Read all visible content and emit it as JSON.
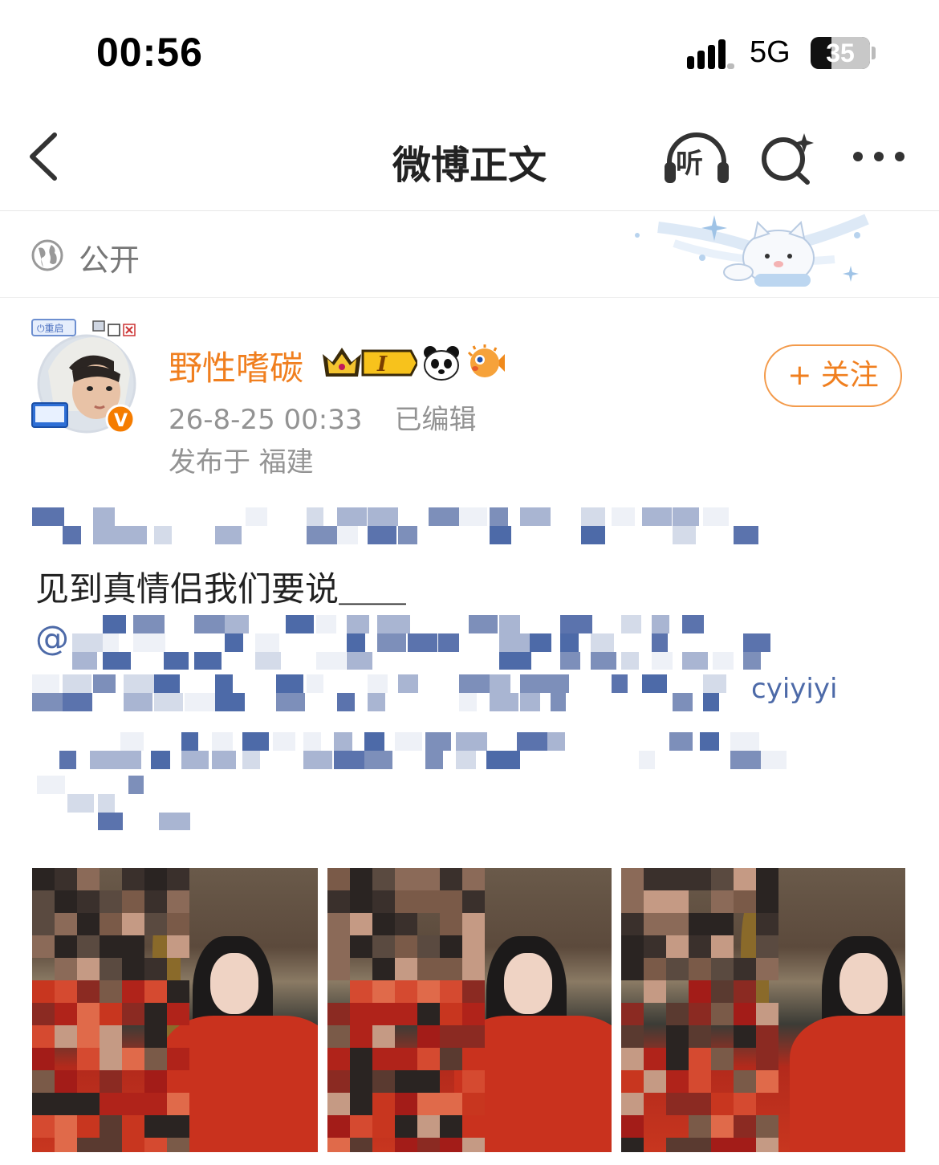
{
  "status_bar": {
    "time": "00:56",
    "network": "5G",
    "battery_level": "35",
    "battery_fraction": 0.35
  },
  "nav": {
    "title": "微博正文",
    "listen_label": "听"
  },
  "visibility": {
    "label": "公开"
  },
  "post": {
    "username": "野性嗜碳",
    "badge_level": "I",
    "timestamp": "26-8-25 00:33",
    "edited": "已编辑",
    "location": "发布于 福建",
    "follow_label": "+ 关注",
    "visible_line": "见到真情侣我们要说＿＿",
    "mention_prefix": "@",
    "partial_handle": "cyiyiyi"
  },
  "colors": {
    "accent_orange": "#f07f1f",
    "link_blue": "#4d6aa8",
    "meta_gray": "#939393"
  },
  "icons": [
    "chevron-left-icon",
    "headphones-icon",
    "search-sparkle-icon",
    "more-icon",
    "globe-icon",
    "verified-v-icon",
    "crown-badge-icon",
    "panda-icon",
    "pufferfish-icon"
  ]
}
